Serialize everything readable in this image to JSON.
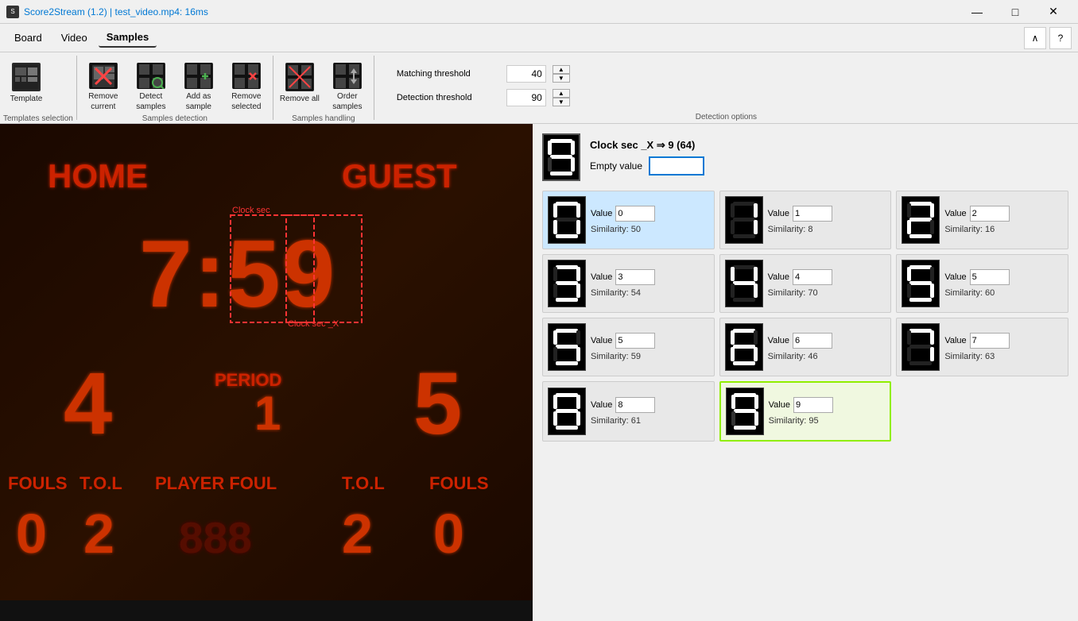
{
  "titlebar": {
    "icon": "S",
    "title": "Score2Stream (1.2) | test_video.mp4: 16ms",
    "title_app": "Score2Stream (1.2)",
    "title_file": " | test_video.mp4: 16ms",
    "minimize": "—",
    "maximize": "□",
    "close": "✕"
  },
  "menubar": {
    "items": [
      {
        "label": "Board",
        "active": false
      },
      {
        "label": "Video",
        "active": false
      },
      {
        "label": "Samples",
        "active": true
      }
    ],
    "collapse_btn": "∧",
    "help_btn": "?"
  },
  "toolbar": {
    "groups": [
      {
        "name": "Templates selection",
        "buttons": [
          {
            "id": "template",
            "label": "Template",
            "icon": "🎬"
          }
        ]
      },
      {
        "name": "Samples detection",
        "buttons": [
          {
            "id": "remove-current",
            "label": "Remove current",
            "icon": "⊟"
          },
          {
            "id": "detect-samples",
            "label": "Detect samples",
            "icon": "⊞"
          },
          {
            "id": "add-as-sample",
            "label": "Add as sample",
            "icon": "⊕"
          },
          {
            "id": "remove-selected",
            "label": "Remove selected",
            "icon": "✂"
          }
        ]
      },
      {
        "name": "Samples handling",
        "buttons": [
          {
            "id": "remove-all",
            "label": "Remove all",
            "icon": "✕"
          },
          {
            "id": "order-samples",
            "label": "Order samples",
            "icon": "⇅"
          }
        ]
      }
    ],
    "detection_options": {
      "label": "Detection options",
      "matching_threshold": {
        "label": "Matching threshold",
        "value": "40"
      },
      "detection_threshold": {
        "label": "Detection threshold",
        "value": "90"
      }
    }
  },
  "clock": {
    "title": "Clock sec _X ⇒ 9 (64)",
    "digit": "9",
    "empty_value_label": "Empty value",
    "empty_value": ""
  },
  "samples": [
    {
      "digit": "0",
      "value": "0",
      "similarity": "50",
      "selected": true,
      "highlighted": false
    },
    {
      "digit": "1",
      "value": "1",
      "similarity": "8",
      "selected": false,
      "highlighted": false
    },
    {
      "digit": "2",
      "value": "2",
      "similarity": "16",
      "selected": false,
      "highlighted": false
    },
    {
      "digit": "3",
      "value": "3",
      "similarity": "54",
      "selected": false,
      "highlighted": false
    },
    {
      "digit": "4",
      "value": "4",
      "similarity": "70",
      "selected": false,
      "highlighted": false
    },
    {
      "digit": "5",
      "value": "5",
      "similarity": "60",
      "selected": false,
      "highlighted": false
    },
    {
      "digit": "5b",
      "value": "5",
      "similarity": "59",
      "selected": false,
      "highlighted": false
    },
    {
      "digit": "6",
      "value": "6",
      "similarity": "46",
      "selected": false,
      "highlighted": false
    },
    {
      "digit": "7",
      "value": "7",
      "similarity": "63",
      "selected": false,
      "highlighted": false
    },
    {
      "digit": "8",
      "value": "8",
      "similarity": "61",
      "selected": false,
      "highlighted": false
    },
    {
      "digit": "9",
      "value": "9",
      "similarity": "95",
      "selected": false,
      "highlighted": true
    }
  ],
  "scoreboard": {
    "home_label": "HOME",
    "guest_label": "GUEST",
    "time": "7:59",
    "period_label": "PERIOD",
    "period": "1",
    "home_score": "4",
    "guest_score": "5",
    "fouls_label": "FOULS",
    "tol_label": "T.O.L",
    "player_foul_label": "PLAYER FOUL",
    "home_fouls": "0",
    "home_tol": "2",
    "guest_tol": "2",
    "guest_fouls": "0"
  },
  "selection_boxes": [
    {
      "label": "Clock sec",
      "color": "#ff4444"
    },
    {
      "label": "Clock sec _X",
      "color": "#ff4444"
    }
  ]
}
